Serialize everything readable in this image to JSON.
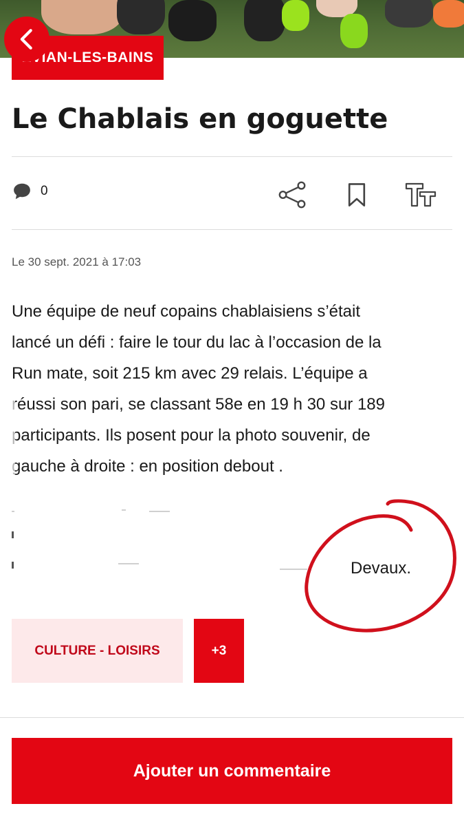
{
  "article": {
    "section": "ÉVIAN-LES-BAINS",
    "title": "Le Chablais en goguette",
    "comment_count": "0",
    "date": "Le 30 sept. 2021 à 17:03",
    "body_lines": [
      "Une équipe de neuf copains chablaisiens s’était",
      "lancé un défi : faire le tour du lac à l’occasion de la",
      "Run mate, soit 215 km avec 29 relais. L’équipe a",
      "réussi son pari, se classant 58e  en 19 h 30 sur 189",
      "participants. Ils posent pour la photo souvenir, de",
      "gauche à droite : en position debout ."
    ],
    "visible_name": "Devaux."
  },
  "toolbar": {
    "icons": [
      "comment-icon",
      "share-icon",
      "bookmark-icon",
      "text-size-icon"
    ]
  },
  "tags": {
    "primary": "CULTURE - LOISIRS",
    "more": "+3"
  },
  "cta": {
    "label": "Ajouter un commentaire"
  },
  "colors": {
    "accent": "#e30613",
    "tag_bg": "#fde9ea",
    "annotation": "#d0101c"
  }
}
